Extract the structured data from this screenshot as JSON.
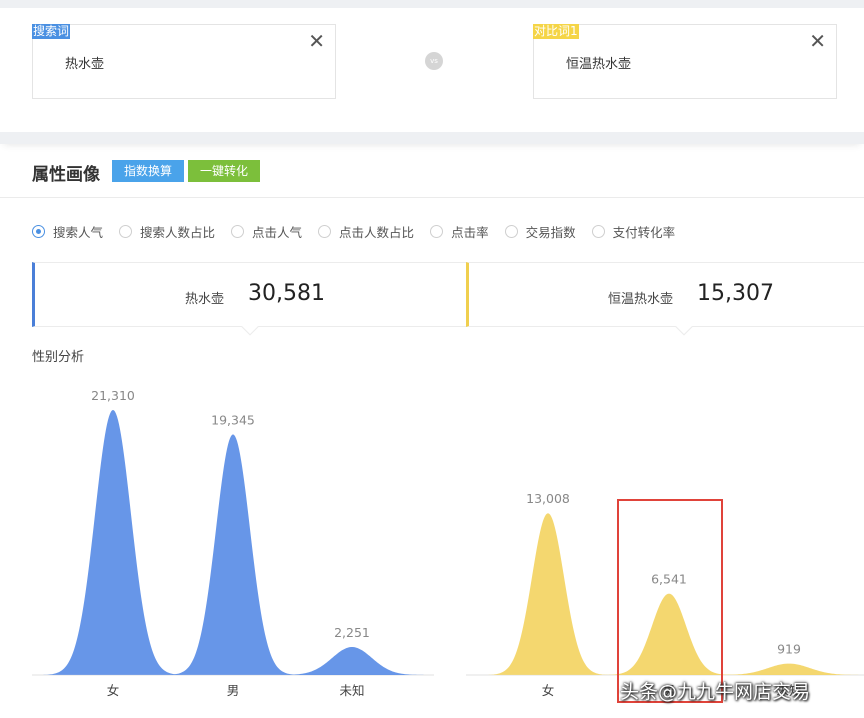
{
  "search": {
    "term_tag": "搜索词",
    "term_value": "热水壶",
    "compare_tag": "对比词1",
    "compare_value": "恒温热水壶",
    "vs": "vs"
  },
  "section": {
    "title": "属性画像",
    "btn_index": "指数换算",
    "btn_convert": "一键转化"
  },
  "metrics": [
    {
      "label": "搜索人气",
      "selected": true
    },
    {
      "label": "搜索人数占比",
      "selected": false
    },
    {
      "label": "点击人气",
      "selected": false
    },
    {
      "label": "点击人数占比",
      "selected": false
    },
    {
      "label": "点击率",
      "selected": false
    },
    {
      "label": "交易指数",
      "selected": false
    },
    {
      "label": "支付转化率",
      "selected": false
    }
  ],
  "stats": {
    "left_name": "热水壶",
    "left_value": "30,581",
    "right_name": "恒温热水壶",
    "right_value": "15,307"
  },
  "chart_label": "性别分析",
  "watermark": "头条@九九牛网店交易",
  "colors": {
    "blue": "#5b8ee6",
    "yellow": "#f3d464",
    "tag_blue": "#4a90e2",
    "tag_yellow": "#f5d547",
    "btn_blue": "#4aa3ea",
    "btn_green": "#7cbf3b",
    "highlight": "#e0433a"
  },
  "chart_data": [
    {
      "type": "area",
      "categories": [
        "女",
        "男",
        "未知"
      ],
      "values": [
        21310,
        19345,
        2251
      ],
      "labels": [
        "21,310",
        "19,345",
        "2,251"
      ],
      "color": "#5b8ee6"
    },
    {
      "type": "area",
      "categories": [
        "女",
        "男",
        "未知"
      ],
      "values": [
        13008,
        6541,
        919
      ],
      "labels": [
        "13,008",
        "6,541",
        "919"
      ],
      "color": "#f3d464"
    }
  ]
}
